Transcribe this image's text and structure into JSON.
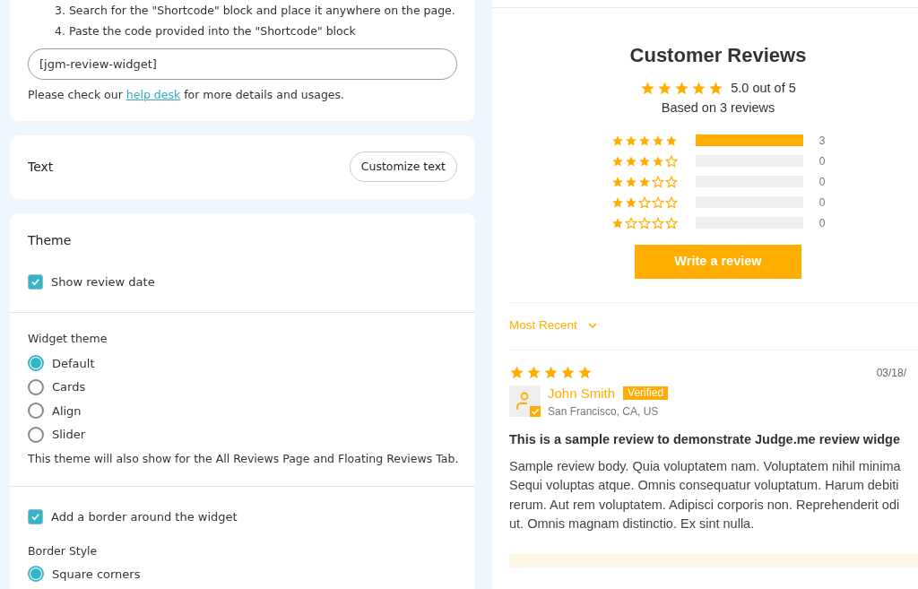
{
  "install_steps": [
    "3. Search for the \"Shortcode\" block and place it anywhere on the page.",
    "4. Paste the code provided into the \"Shortcode\" block"
  ],
  "shortcode_field": {
    "value": "[jgm-review-widget]"
  },
  "help": {
    "before": "Please check our",
    "link": "help desk",
    "after": "for more details and usages."
  },
  "text_card": {
    "title": "Text",
    "button": "Customize text"
  },
  "theme_card": {
    "title": "Theme",
    "show_review_date": {
      "label": "Show review date",
      "checked": true
    },
    "widget_theme": {
      "label": "Widget theme",
      "options": [
        {
          "label": "Default",
          "selected": true
        },
        {
          "label": "Cards",
          "selected": false
        },
        {
          "label": "Align",
          "selected": false
        },
        {
          "label": "Slider",
          "selected": false
        }
      ],
      "note": "This theme will also show for the All Reviews Page and Floating Reviews Tab."
    },
    "border": {
      "label": "Add a border around the widget",
      "checked": true
    },
    "border_style": {
      "label": "Border Style",
      "options": [
        {
          "label": "Square corners",
          "selected": true
        }
      ]
    }
  },
  "widget": {
    "title": "Customer Reviews",
    "stars": 5,
    "average": "5.0 out of 5",
    "based_on": "Based on 3 reviews",
    "histogram": [
      {
        "stars": 5,
        "level": 1,
        "count": "3"
      },
      {
        "stars": 4,
        "level": 0,
        "count": "0"
      },
      {
        "stars": 3,
        "level": 0,
        "count": "0"
      },
      {
        "stars": 2,
        "level": 0,
        "count": "0"
      },
      {
        "stars": 1,
        "level": 0,
        "count": "0"
      }
    ],
    "write_button": "Write a review",
    "sort": "Most Recent",
    "review": {
      "stars": 5,
      "date": "03/18/",
      "author": "John Smith",
      "badge": "Verified",
      "location": "San Francisco, CA, US",
      "title": "This is a sample review to demonstrate Judge.me review widge",
      "body": [
        "Sample review body. Quia voluptatem nam. Voluptatem nihil minima",
        "Sequi voluptas atque. Omnis consequatur voluptatum. Harum debiti",
        "rerum. Aut rem voluptatem. Adipisci corporis non. Reprehenderit odi",
        "ut. Omnis magnam distinctio. Ex sint nulla."
      ]
    }
  }
}
